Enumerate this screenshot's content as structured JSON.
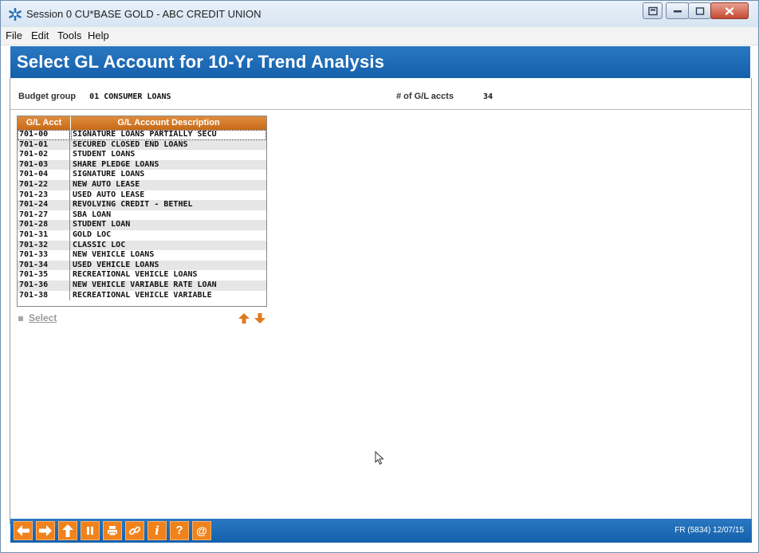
{
  "window": {
    "title": "Session 0 CU*BASE GOLD - ABC CREDIT UNION",
    "app_icon": "asterisk-logo-icon",
    "controls": [
      "restore-doc-icon",
      "minimize-icon",
      "maximize-icon",
      "close-icon"
    ]
  },
  "menu": {
    "items": [
      "File",
      "Edit",
      "Tools",
      "Help"
    ]
  },
  "header": {
    "title": "Select GL Account for 10-Yr Trend Analysis"
  },
  "info": {
    "budget_group_label": "Budget group",
    "budget_group_value": "01 CONSUMER LOANS",
    "gl_count_label": "# of G/L accts",
    "gl_count_value": "34"
  },
  "table": {
    "columns": [
      "G/L Acct",
      "G/L Account Description"
    ],
    "rows": [
      [
        "701-00",
        "SIGNATURE LOANS PARTIALLY SECU"
      ],
      [
        "701-01",
        "SECURED CLOSED END LOANS"
      ],
      [
        "701-02",
        "STUDENT LOANS"
      ],
      [
        "701-03",
        "SHARE PLEDGE LOANS"
      ],
      [
        "701-04",
        "SIGNATURE LOANS"
      ],
      [
        "701-22",
        "NEW AUTO LEASE"
      ],
      [
        "701-23",
        "USED AUTO LEASE"
      ],
      [
        "701-24",
        "REVOLVING CREDIT - BETHEL"
      ],
      [
        "701-27",
        "SBA LOAN"
      ],
      [
        "701-28",
        "STUDENT LOAN"
      ],
      [
        "701-31",
        "GOLD LOC"
      ],
      [
        "701-32",
        "CLASSIC LOC"
      ],
      [
        "701-33",
        "NEW VEHICLE LOANS"
      ],
      [
        "701-34",
        "USED VEHICLE LOANS"
      ],
      [
        "701-35",
        "RECREATIONAL VEHICLE LOANS"
      ],
      [
        "701-36",
        "NEW VEHICLE VARIABLE RATE LOAN"
      ],
      [
        "701-38",
        "RECREATIONAL VEHICLE VARIABLE"
      ]
    ]
  },
  "actions": {
    "select_label": "Select"
  },
  "footer": {
    "status": "FR (5834) 12/07/15",
    "accent_color": "#f0821b",
    "buttons": [
      "back-icon",
      "forward-icon",
      "up-icon",
      "pause-icon",
      "print-icon",
      "link-icon",
      "info-icon",
      "help-icon",
      "email-icon"
    ],
    "info_glyph": "i",
    "help_glyph": "?",
    "email_glyph": "@"
  },
  "colors": {
    "header_blue": "#1f6db8",
    "grid_header_orange": "#d97a26"
  }
}
